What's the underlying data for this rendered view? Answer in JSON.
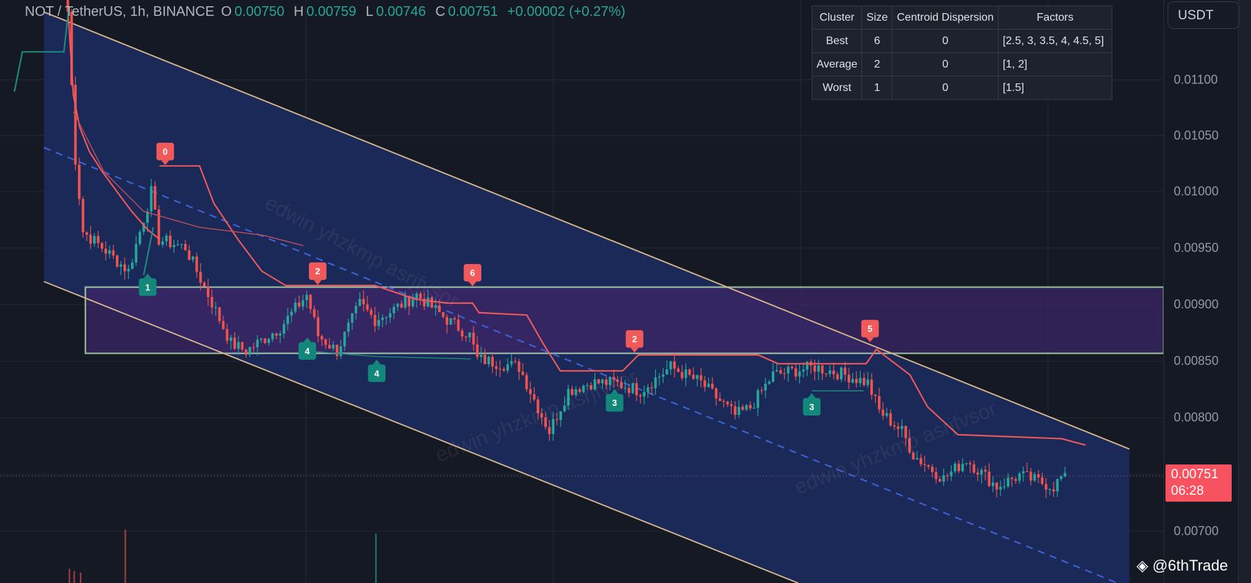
{
  "header": {
    "symbol": "NOT / TetherUS, 1h, BINANCE",
    "o_label": "O",
    "o": "0.00750",
    "h_label": "H",
    "h": "0.00759",
    "l_label": "L",
    "l": "0.00746",
    "c_label": "C",
    "c": "0.00751",
    "change": "+0.00002 (+0.27%)"
  },
  "currency_button": "USDT",
  "cluster_table": {
    "headers": [
      "Cluster",
      "Size",
      "Centroid Dispersion",
      "Factors"
    ],
    "rows": [
      [
        "Best",
        "6",
        "0",
        "[2.5, 3, 3.5, 4, 4.5, 5]"
      ],
      [
        "Average",
        "2",
        "0",
        "[1, 2]"
      ],
      [
        "Worst",
        "1",
        "0",
        "[1.5]"
      ]
    ]
  },
  "price_axis": [
    "0.01100",
    "0.01050",
    "0.01000",
    "0.00950",
    "0.00900",
    "0.00850",
    "0.00800",
    "0.00700"
  ],
  "last_price": {
    "value": "0.00751",
    "countdown": "06:28"
  },
  "signals": {
    "bearish": [
      "0",
      "2",
      "6",
      "2",
      "5"
    ],
    "bullish": [
      "1",
      "4",
      "4",
      "3",
      "3"
    ]
  },
  "watermark_text": "edwin yhzkmp asrjfvsor",
  "credit": "@6thTrade",
  "colors": {
    "up": "#26a69a",
    "down": "#ef5350",
    "channel": "#1c2b5e",
    "zone": "#3b2566",
    "zone_border": "#b9e6b9",
    "trail": "#f05a5a"
  },
  "chart_data": {
    "type": "candlestick",
    "title": "NOT / TetherUS, 1h, BINANCE",
    "ylabel": "USDT",
    "ylim": [
      0.0066,
      0.012
    ],
    "price_path": [
      [
        0,
        0.0116
      ],
      [
        2,
        0.01029
      ],
      [
        4,
        0.00965
      ],
      [
        9,
        0.00951
      ],
      [
        16,
        0.0093
      ],
      [
        22,
        0.01
      ],
      [
        24,
        0.00958
      ],
      [
        31,
        0.00951
      ],
      [
        37,
        0.00909
      ],
      [
        43,
        0.00866
      ],
      [
        47,
        0.00859
      ],
      [
        56,
        0.0088
      ],
      [
        63,
        0.00909
      ],
      [
        66,
        0.00873
      ],
      [
        71,
        0.00859
      ],
      [
        77,
        0.00901
      ],
      [
        81,
        0.00887
      ],
      [
        85,
        0.00894
      ],
      [
        92,
        0.00909
      ],
      [
        100,
        0.00887
      ],
      [
        106,
        0.00873
      ],
      [
        108,
        0.00852
      ],
      [
        119,
        0.00845
      ],
      [
        125,
        0.00802
      ],
      [
        127,
        0.00788
      ],
      [
        132,
        0.00824
      ],
      [
        138,
        0.00831
      ],
      [
        144,
        0.00831
      ],
      [
        151,
        0.00824
      ],
      [
        159,
        0.00845
      ],
      [
        167,
        0.00831
      ],
      [
        176,
        0.00802
      ],
      [
        180,
        0.00809
      ],
      [
        186,
        0.00838
      ],
      [
        197,
        0.00845
      ],
      [
        205,
        0.00838
      ],
      [
        211,
        0.00831
      ],
      [
        214,
        0.00806
      ],
      [
        220,
        0.00788
      ],
      [
        223,
        0.00767
      ],
      [
        231,
        0.00746
      ],
      [
        237,
        0.00763
      ],
      [
        245,
        0.00739
      ],
      [
        251,
        0.00749
      ],
      [
        260,
        0.00739
      ],
      [
        263,
        0.00751
      ]
    ],
    "zone": [
      0.00858,
      0.00917
    ]
  }
}
